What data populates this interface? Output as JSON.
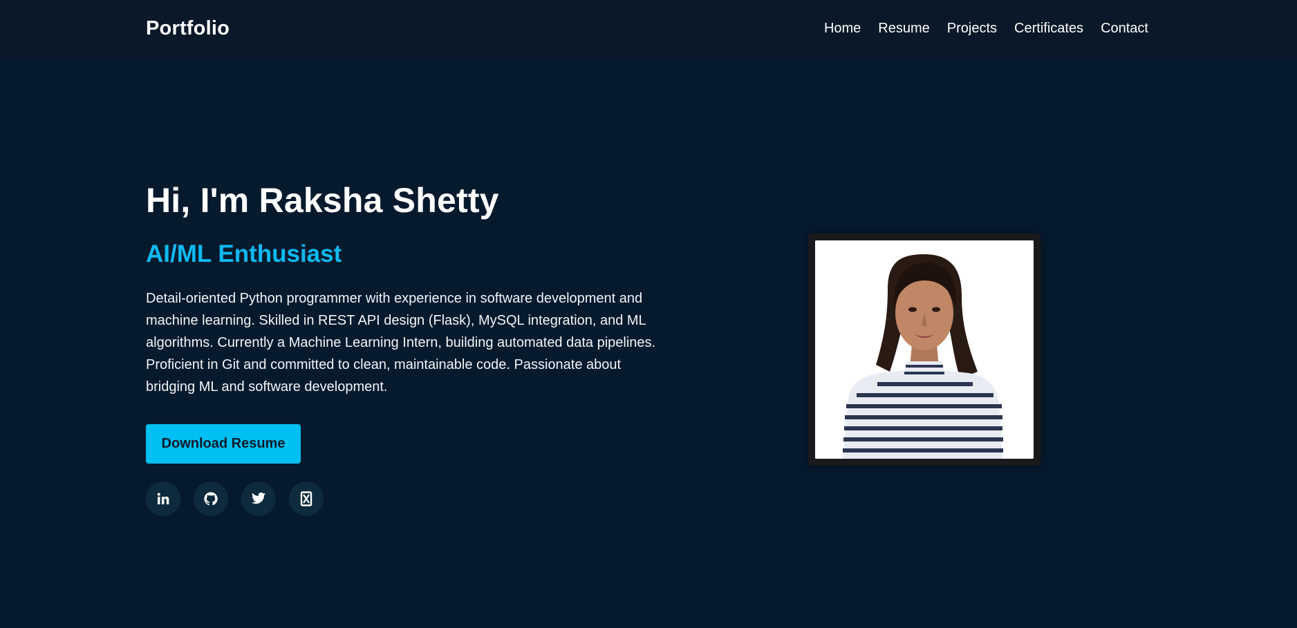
{
  "navbar": {
    "brand": "Portfolio",
    "links": [
      "Home",
      "Resume",
      "Projects",
      "Certificates",
      "Contact"
    ]
  },
  "hero": {
    "title": "Hi, I'm Raksha Shetty",
    "subtitle": "AI/ML Enthusiast",
    "description": "Detail-oriented Python programmer with experience in software development and machine learning. Skilled in REST API design (Flask), MySQL integration, and ML algorithms. Currently a Machine Learning Intern, building automated data pipelines. Proficient in Git and committed to clean, maintainable code. Passionate about bridging ML and software development.",
    "download_label": "Download Resume"
  },
  "social": {
    "icons": [
      "linkedin-icon",
      "github-icon",
      "twitter-icon",
      "kaggle-icon"
    ]
  },
  "colors": {
    "page_bg": "#061a2e",
    "navbar_bg": "#0a1929",
    "accent": "#0fbaf2",
    "button_bg": "#00bff2",
    "social_bg": "#0e2b3d"
  }
}
